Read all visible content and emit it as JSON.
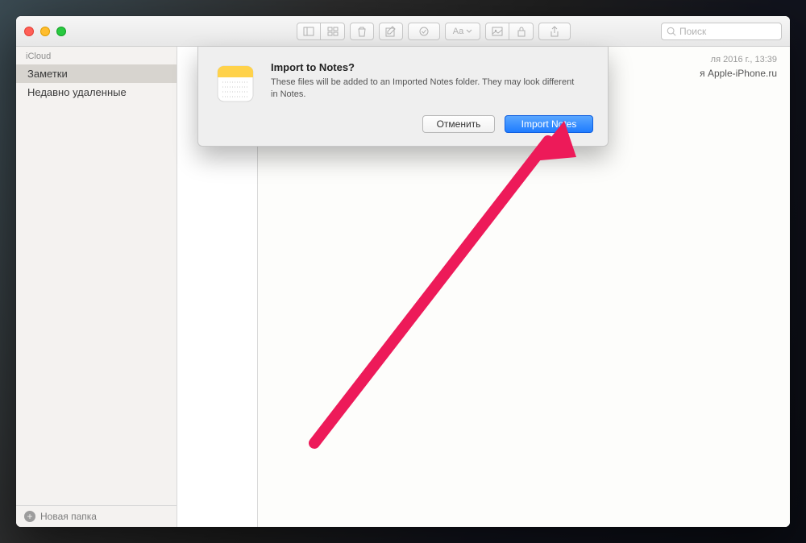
{
  "sidebar": {
    "group_label": "iCloud",
    "items": [
      {
        "label": "Заметки",
        "selected": true
      },
      {
        "label": "Недавно удаленные",
        "selected": false
      }
    ],
    "footer_label": "Новая папка"
  },
  "search": {
    "placeholder": "Поиск"
  },
  "note": {
    "date": "ля 2016 г., 13:39",
    "visible_text": "я Apple-iPhone.ru"
  },
  "dialog": {
    "title": "Import to Notes?",
    "message": "These files will be added to an Imported Notes folder. They may look different in Notes.",
    "cancel_label": "Отменить",
    "confirm_label": "Import Notes"
  }
}
